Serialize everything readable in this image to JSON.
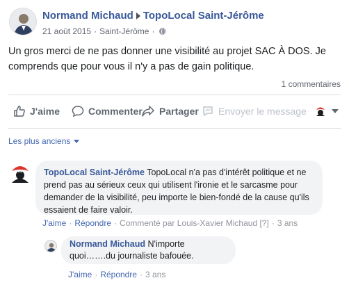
{
  "post": {
    "author": "Normand Michaud",
    "target_page": "TopoLocal Saint-Jérôme",
    "date": "21 août 2015",
    "location": "Saint-Jérôme",
    "meta_separator": "·",
    "privacy_icon": "globe-icon",
    "text": "Un gros merci de ne pas donner une visibilité au projet SAC À DOS. Je comprends que pour vous il n'y a pas de gain politique.",
    "comment_count": "1 commentaires"
  },
  "actions": {
    "like": "J'aime",
    "comment": "Commenter",
    "share": "Partager",
    "send": "Envoyer le message"
  },
  "comments_sort": "Les plus anciens",
  "comments": [
    {
      "author": "TopoLocal Saint-Jérôme",
      "text": "TopoLocal n'a pas d'intérêt politique et ne prend pas au sérieux ceux qui utilisent l'ironie et le sarcasme pour demander de la visibilité, peu importe le bien-fondé de la cause qu'ils essaient de faire valoir.",
      "like": "J'aime",
      "reply": "Répondre",
      "commented_by": "Commenté par Louis-Xavier Michaud",
      "badge": "[?]",
      "time": "3 ans",
      "separator": "·"
    },
    {
      "author": "Normand Michaud",
      "text": "N'importe quoi…….du journaliste bafouée.",
      "like": "J'aime",
      "reply": "Répondre",
      "time": "3 ans",
      "separator": "·"
    }
  ],
  "colors": {
    "link": "#385898",
    "accent": "#4267b2",
    "muted": "#616770",
    "bubble": "#f2f3f5",
    "brand_red": "#e0322d"
  }
}
